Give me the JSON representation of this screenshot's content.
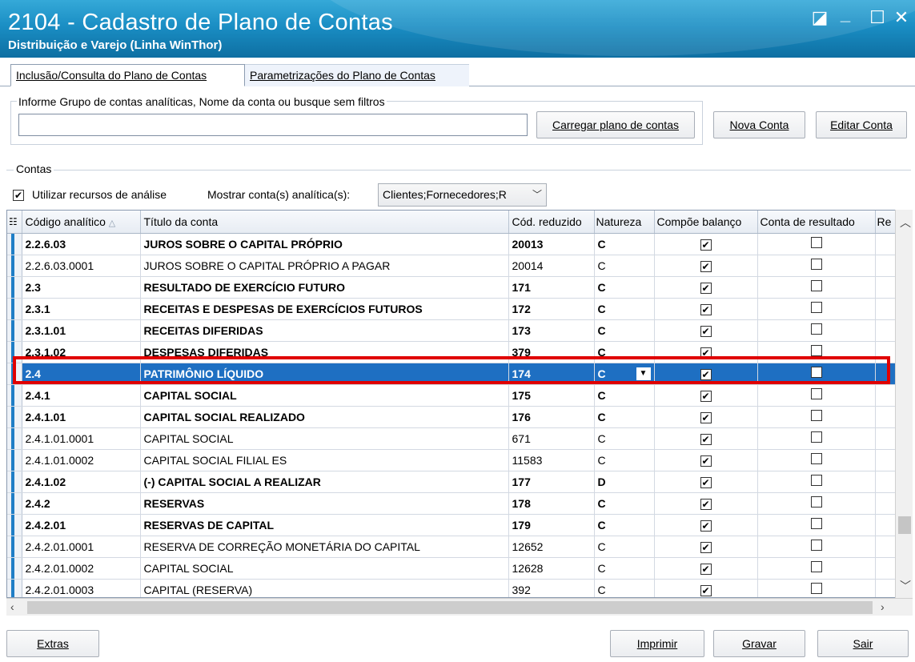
{
  "window": {
    "title": "2104 - Cadastro de Plano de Contas",
    "subtitle": "Distribuição e Varejo (Linha WinThor)",
    "controls": {
      "restore": "◪",
      "minimize": "_",
      "maximize": "☐",
      "close": "✕"
    }
  },
  "tabs": [
    {
      "label": "Inclusão/Consulta do Plano de Contas",
      "active": true
    },
    {
      "label": "Parametrizações do Plano de Contas",
      "active": false
    }
  ],
  "search": {
    "group_label": "Informe Grupo de contas analíticas, Nome da conta ou busque sem filtros",
    "value": "",
    "load_button": "Carregar plano de contas"
  },
  "actions": {
    "new_account": "Nova Conta",
    "edit_account": "Editar Conta"
  },
  "contas": {
    "group_label": "Contas",
    "use_analysis_label": "Utilizar recursos de análise",
    "use_analysis_checked": true,
    "show_accounts_label": "Mostrar conta(s) analítica(s):",
    "show_accounts_value": "Clientes;Fornecedores;R"
  },
  "grid": {
    "columns": [
      "Código analítico",
      "Título da conta",
      "Cód. reduzido",
      "Natureza",
      "Compõe balanço",
      "Conta de resultado",
      "Re"
    ],
    "rows": [
      {
        "code": "2.2.6.03",
        "title": "JUROS SOBRE O CAPITAL PRÓPRIO",
        "reduced": "20013",
        "nature": "C",
        "bold": true
      },
      {
        "code": "2.2.6.03.0001",
        "title": "JUROS SOBRE O CAPITAL PRÓPRIO A PAGAR",
        "reduced": "20014",
        "nature": "C",
        "bold": false
      },
      {
        "code": "2.3",
        "title": "RESULTADO DE EXERCÍCIO FUTURO",
        "reduced": "171",
        "nature": "C",
        "bold": true
      },
      {
        "code": "2.3.1",
        "title": "RECEITAS E DESPESAS DE EXERCÍCIOS FUTUROS",
        "reduced": "172",
        "nature": "C",
        "bold": true
      },
      {
        "code": "2.3.1.01",
        "title": "RECEITAS DIFERIDAS",
        "reduced": "173",
        "nature": "C",
        "bold": true
      },
      {
        "code": "2.3.1.02",
        "title": "DESPESAS DIFERIDAS",
        "reduced": "379",
        "nature": "C",
        "bold": true
      },
      {
        "code": "2.4",
        "title": "PATRIMÔNIO LÍQUIDO",
        "reduced": "174",
        "nature": "C",
        "bold": true,
        "selected": true
      },
      {
        "code": "2.4.1",
        "title": "CAPITAL SOCIAL",
        "reduced": "175",
        "nature": "C",
        "bold": true
      },
      {
        "code": "2.4.1.01",
        "title": "CAPITAL SOCIAL REALIZADO",
        "reduced": "176",
        "nature": "C",
        "bold": true
      },
      {
        "code": "2.4.1.01.0001",
        "title": "CAPITAL SOCIAL",
        "reduced": "671",
        "nature": "C",
        "bold": false
      },
      {
        "code": "2.4.1.01.0002",
        "title": "CAPITAL SOCIAL FILIAL ES",
        "reduced": "11583",
        "nature": "C",
        "bold": false
      },
      {
        "code": "2.4.1.02",
        "title": "(-) CAPITAL SOCIAL A REALIZAR",
        "reduced": "177",
        "nature": "D",
        "bold": true
      },
      {
        "code": "2.4.2",
        "title": "RESERVAS",
        "reduced": "178",
        "nature": "C",
        "bold": true
      },
      {
        "code": "2.4.2.01",
        "title": "RESERVAS DE CAPITAL",
        "reduced": "179",
        "nature": "C",
        "bold": true
      },
      {
        "code": "2.4.2.01.0001",
        "title": "RESERVA DE CORREÇÃO MONETÁRIA DO CAPITAL",
        "reduced": "12652",
        "nature": "C",
        "bold": false
      },
      {
        "code": "2.4.2.01.0002",
        "title": "CAPITAL SOCIAL",
        "reduced": "12628",
        "nature": "C",
        "bold": false
      },
      {
        "code": "2.4.2.01.0003",
        "title": "CAPITAL (RESERVA)",
        "reduced": "392",
        "nature": "C",
        "bold": false
      }
    ],
    "compoe_balanco_checked": true,
    "conta_resultado_checked": false,
    "check_glyph": "✔"
  },
  "footer": {
    "extras": "Extras",
    "print": "Imprimir",
    "save": "Gravar",
    "exit": "Sair"
  },
  "colors": {
    "titlebar": "#1a8ec4",
    "selection": "#1e6fc2",
    "highlight": "#e00000"
  }
}
